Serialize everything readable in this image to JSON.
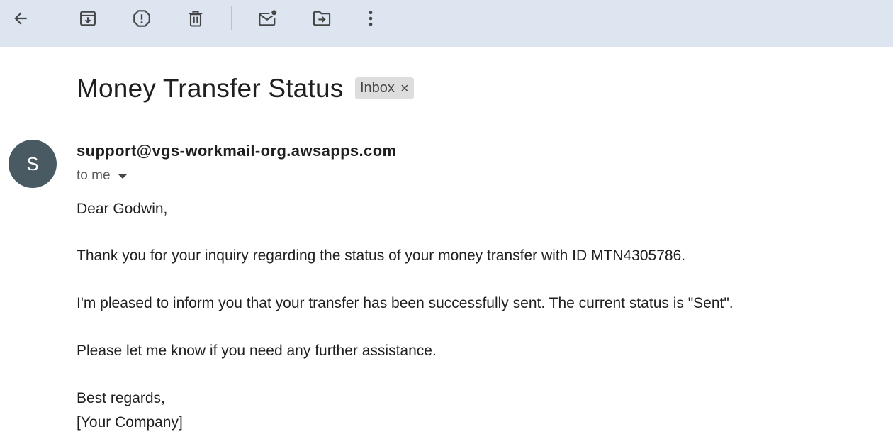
{
  "toolbar": {
    "actions": [
      {
        "icon": "arrow-back-icon",
        "label": "Back"
      },
      {
        "icon": "archive-icon",
        "label": "Archive"
      },
      {
        "icon": "report-spam-icon",
        "label": "Report spam"
      },
      {
        "icon": "delete-icon",
        "label": "Delete"
      },
      {
        "icon": "mark-unread-icon",
        "label": "Mark as unread"
      },
      {
        "icon": "move-to-icon",
        "label": "Move to"
      },
      {
        "icon": "more-vert-icon",
        "label": "More"
      }
    ]
  },
  "email": {
    "subject": "Money Transfer Status",
    "label": "Inbox",
    "label_close": "×",
    "sender_initial": "S",
    "sender": "support@vgs-workmail-org.awsapps.com",
    "recipient": "to me",
    "body": {
      "greeting": "Dear Godwin,",
      "line1": "Thank you for your inquiry regarding the status of your money transfer with ID MTN4305786.",
      "line2": "I'm pleased to inform you that your transfer has been successfully sent. The current status is \"Sent\".",
      "line3": "Please let me know if you need any further assistance.",
      "closing": "Best regards,",
      "signature": "[Your Company]"
    }
  },
  "colors": {
    "toolbar_bg": "#dde5f1",
    "avatar_bg": "#4a5a63",
    "chip_bg": "#dddddd",
    "icon": "#444746"
  }
}
